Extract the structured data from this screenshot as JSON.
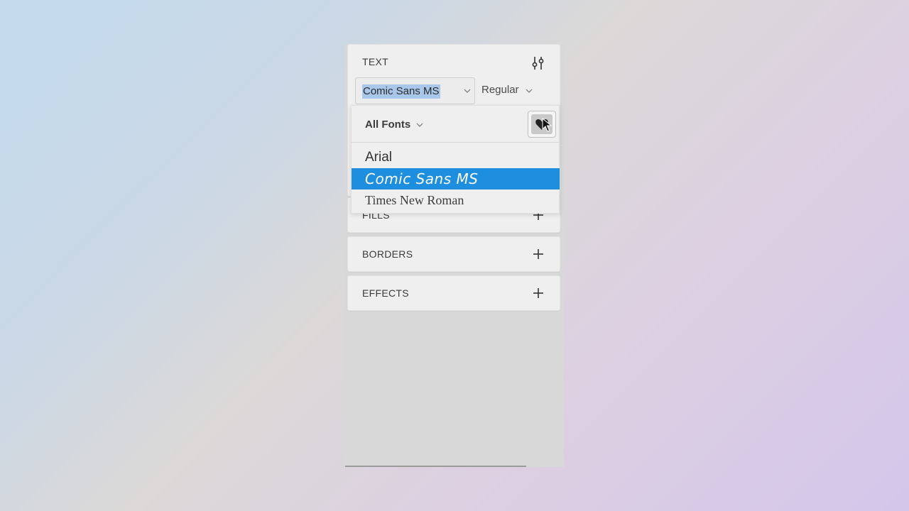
{
  "text_section": {
    "title": "TEXT",
    "font_family_value": "Comic Sans MS",
    "font_weight_value": "Regular"
  },
  "font_dropdown": {
    "filter_label": "All Fonts",
    "fonts": [
      "Arial",
      "Comic Sans MS",
      "Times New Roman"
    ],
    "selected": "Comic Sans MS"
  },
  "fills": {
    "title": "FILLS"
  },
  "borders": {
    "title": "BORDERS"
  },
  "effects": {
    "title": "EFFECTS"
  },
  "colors": {
    "accent": "#1e8fdf",
    "selection": "#a8c7ea"
  }
}
